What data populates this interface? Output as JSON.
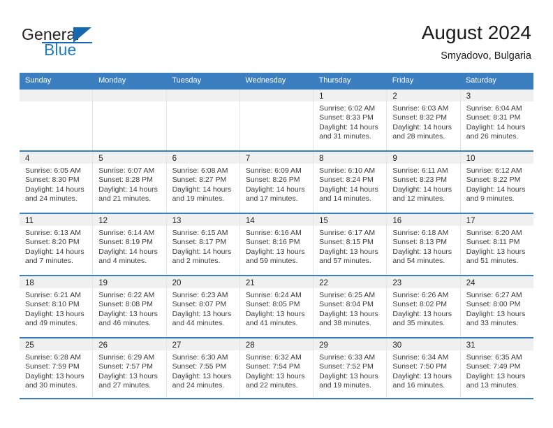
{
  "brand": {
    "name_part1": "General",
    "name_part2": "Blue",
    "accent_color": "#1668b0"
  },
  "header": {
    "month_title": "August 2024",
    "location": "Smyadovo, Bulgaria"
  },
  "calendar": {
    "header_bg": "#3c7fc1",
    "weekdays": [
      "Sunday",
      "Monday",
      "Tuesday",
      "Wednesday",
      "Thursday",
      "Friday",
      "Saturday"
    ],
    "weeks": [
      [
        {
          "day": "",
          "sunrise": "",
          "sunset": "",
          "daylight_line1": "",
          "daylight_line2": "",
          "empty": true
        },
        {
          "day": "",
          "sunrise": "",
          "sunset": "",
          "daylight_line1": "",
          "daylight_line2": "",
          "empty": true
        },
        {
          "day": "",
          "sunrise": "",
          "sunset": "",
          "daylight_line1": "",
          "daylight_line2": "",
          "empty": true
        },
        {
          "day": "",
          "sunrise": "",
          "sunset": "",
          "daylight_line1": "",
          "daylight_line2": "",
          "empty": true
        },
        {
          "day": "1",
          "sunrise": "Sunrise: 6:02 AM",
          "sunset": "Sunset: 8:33 PM",
          "daylight_line1": "Daylight: 14 hours",
          "daylight_line2": "and 31 minutes."
        },
        {
          "day": "2",
          "sunrise": "Sunrise: 6:03 AM",
          "sunset": "Sunset: 8:32 PM",
          "daylight_line1": "Daylight: 14 hours",
          "daylight_line2": "and 28 minutes."
        },
        {
          "day": "3",
          "sunrise": "Sunrise: 6:04 AM",
          "sunset": "Sunset: 8:31 PM",
          "daylight_line1": "Daylight: 14 hours",
          "daylight_line2": "and 26 minutes."
        }
      ],
      [
        {
          "day": "4",
          "sunrise": "Sunrise: 6:05 AM",
          "sunset": "Sunset: 8:30 PM",
          "daylight_line1": "Daylight: 14 hours",
          "daylight_line2": "and 24 minutes."
        },
        {
          "day": "5",
          "sunrise": "Sunrise: 6:07 AM",
          "sunset": "Sunset: 8:28 PM",
          "daylight_line1": "Daylight: 14 hours",
          "daylight_line2": "and 21 minutes."
        },
        {
          "day": "6",
          "sunrise": "Sunrise: 6:08 AM",
          "sunset": "Sunset: 8:27 PM",
          "daylight_line1": "Daylight: 14 hours",
          "daylight_line2": "and 19 minutes."
        },
        {
          "day": "7",
          "sunrise": "Sunrise: 6:09 AM",
          "sunset": "Sunset: 8:26 PM",
          "daylight_line1": "Daylight: 14 hours",
          "daylight_line2": "and 17 minutes."
        },
        {
          "day": "8",
          "sunrise": "Sunrise: 6:10 AM",
          "sunset": "Sunset: 8:24 PM",
          "daylight_line1": "Daylight: 14 hours",
          "daylight_line2": "and 14 minutes."
        },
        {
          "day": "9",
          "sunrise": "Sunrise: 6:11 AM",
          "sunset": "Sunset: 8:23 PM",
          "daylight_line1": "Daylight: 14 hours",
          "daylight_line2": "and 12 minutes."
        },
        {
          "day": "10",
          "sunrise": "Sunrise: 6:12 AM",
          "sunset": "Sunset: 8:22 PM",
          "daylight_line1": "Daylight: 14 hours",
          "daylight_line2": "and 9 minutes."
        }
      ],
      [
        {
          "day": "11",
          "sunrise": "Sunrise: 6:13 AM",
          "sunset": "Sunset: 8:20 PM",
          "daylight_line1": "Daylight: 14 hours",
          "daylight_line2": "and 7 minutes."
        },
        {
          "day": "12",
          "sunrise": "Sunrise: 6:14 AM",
          "sunset": "Sunset: 8:19 PM",
          "daylight_line1": "Daylight: 14 hours",
          "daylight_line2": "and 4 minutes."
        },
        {
          "day": "13",
          "sunrise": "Sunrise: 6:15 AM",
          "sunset": "Sunset: 8:17 PM",
          "daylight_line1": "Daylight: 14 hours",
          "daylight_line2": "and 2 minutes."
        },
        {
          "day": "14",
          "sunrise": "Sunrise: 6:16 AM",
          "sunset": "Sunset: 8:16 PM",
          "daylight_line1": "Daylight: 13 hours",
          "daylight_line2": "and 59 minutes."
        },
        {
          "day": "15",
          "sunrise": "Sunrise: 6:17 AM",
          "sunset": "Sunset: 8:15 PM",
          "daylight_line1": "Daylight: 13 hours",
          "daylight_line2": "and 57 minutes."
        },
        {
          "day": "16",
          "sunrise": "Sunrise: 6:18 AM",
          "sunset": "Sunset: 8:13 PM",
          "daylight_line1": "Daylight: 13 hours",
          "daylight_line2": "and 54 minutes."
        },
        {
          "day": "17",
          "sunrise": "Sunrise: 6:20 AM",
          "sunset": "Sunset: 8:11 PM",
          "daylight_line1": "Daylight: 13 hours",
          "daylight_line2": "and 51 minutes."
        }
      ],
      [
        {
          "day": "18",
          "sunrise": "Sunrise: 6:21 AM",
          "sunset": "Sunset: 8:10 PM",
          "daylight_line1": "Daylight: 13 hours",
          "daylight_line2": "and 49 minutes."
        },
        {
          "day": "19",
          "sunrise": "Sunrise: 6:22 AM",
          "sunset": "Sunset: 8:08 PM",
          "daylight_line1": "Daylight: 13 hours",
          "daylight_line2": "and 46 minutes."
        },
        {
          "day": "20",
          "sunrise": "Sunrise: 6:23 AM",
          "sunset": "Sunset: 8:07 PM",
          "daylight_line1": "Daylight: 13 hours",
          "daylight_line2": "and 44 minutes."
        },
        {
          "day": "21",
          "sunrise": "Sunrise: 6:24 AM",
          "sunset": "Sunset: 8:05 PM",
          "daylight_line1": "Daylight: 13 hours",
          "daylight_line2": "and 41 minutes."
        },
        {
          "day": "22",
          "sunrise": "Sunrise: 6:25 AM",
          "sunset": "Sunset: 8:04 PM",
          "daylight_line1": "Daylight: 13 hours",
          "daylight_line2": "and 38 minutes."
        },
        {
          "day": "23",
          "sunrise": "Sunrise: 6:26 AM",
          "sunset": "Sunset: 8:02 PM",
          "daylight_line1": "Daylight: 13 hours",
          "daylight_line2": "and 35 minutes."
        },
        {
          "day": "24",
          "sunrise": "Sunrise: 6:27 AM",
          "sunset": "Sunset: 8:00 PM",
          "daylight_line1": "Daylight: 13 hours",
          "daylight_line2": "and 33 minutes."
        }
      ],
      [
        {
          "day": "25",
          "sunrise": "Sunrise: 6:28 AM",
          "sunset": "Sunset: 7:59 PM",
          "daylight_line1": "Daylight: 13 hours",
          "daylight_line2": "and 30 minutes."
        },
        {
          "day": "26",
          "sunrise": "Sunrise: 6:29 AM",
          "sunset": "Sunset: 7:57 PM",
          "daylight_line1": "Daylight: 13 hours",
          "daylight_line2": "and 27 minutes."
        },
        {
          "day": "27",
          "sunrise": "Sunrise: 6:30 AM",
          "sunset": "Sunset: 7:55 PM",
          "daylight_line1": "Daylight: 13 hours",
          "daylight_line2": "and 24 minutes."
        },
        {
          "day": "28",
          "sunrise": "Sunrise: 6:32 AM",
          "sunset": "Sunset: 7:54 PM",
          "daylight_line1": "Daylight: 13 hours",
          "daylight_line2": "and 22 minutes."
        },
        {
          "day": "29",
          "sunrise": "Sunrise: 6:33 AM",
          "sunset": "Sunset: 7:52 PM",
          "daylight_line1": "Daylight: 13 hours",
          "daylight_line2": "and 19 minutes."
        },
        {
          "day": "30",
          "sunrise": "Sunrise: 6:34 AM",
          "sunset": "Sunset: 7:50 PM",
          "daylight_line1": "Daylight: 13 hours",
          "daylight_line2": "and 16 minutes."
        },
        {
          "day": "31",
          "sunrise": "Sunrise: 6:35 AM",
          "sunset": "Sunset: 7:49 PM",
          "daylight_line1": "Daylight: 13 hours",
          "daylight_line2": "and 13 minutes."
        }
      ]
    ]
  }
}
